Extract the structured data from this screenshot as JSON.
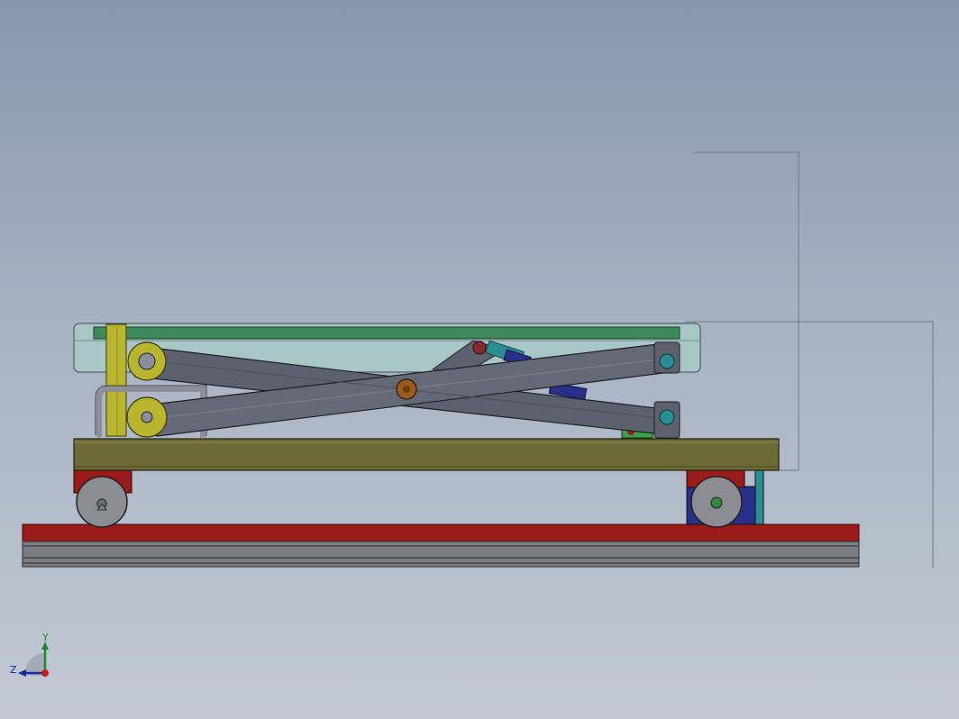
{
  "viewport": {
    "background_top": "#8797ac",
    "background_bottom": "#c2c9d4"
  },
  "model": {
    "parts": {
      "platform": "glass-top-platform",
      "scissor": "scissor-arms",
      "base": "olive-base-frame",
      "rail": "red-guide-rail",
      "wheels": "caster-wheels",
      "actuator": "hydraulic-cylinder"
    },
    "colors": {
      "glass": "#a8c9c6",
      "green_rail": "#3e8a5a",
      "arm": "#5b616f",
      "olive": "#6c6b38",
      "yellow": "#b9b52e",
      "red": "#9b1a1a",
      "wheel": "#8c8d92",
      "navy": "#28308a",
      "teal": "#2a8f92",
      "bronze": "#9b5a1e"
    }
  },
  "triad": {
    "y_label": "Y",
    "z_label": "Z",
    "icon": "axis-triad-icon"
  }
}
